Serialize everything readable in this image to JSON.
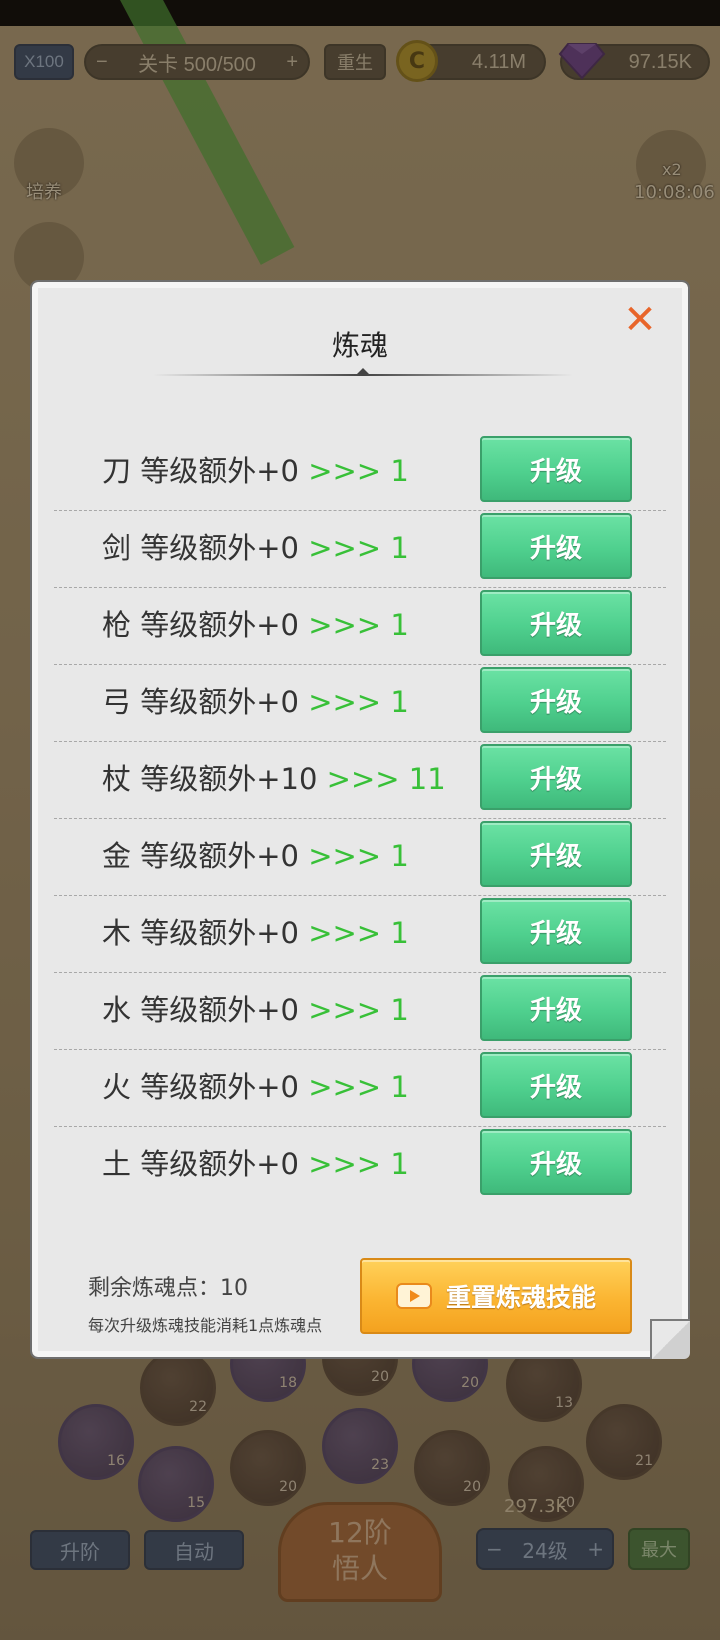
{
  "hud": {
    "multiplier": "X100",
    "stage_label": "关卡",
    "stage_value": "500",
    "stage_max": "500",
    "rebirth": "重生",
    "coins": "4.11M",
    "gems": "97.15K",
    "coin_symbol": "C"
  },
  "side": {
    "train_label": "培养",
    "boost_label": "x2",
    "timer": "10:08:06"
  },
  "bottom": {
    "upgrade_rank": "升阶",
    "auto": "自动",
    "rank_line1": "12阶",
    "rank_line2": "悟人",
    "level_value": "24级",
    "minus": "−",
    "plus": "+",
    "max": "最大",
    "cost": "297.3K"
  },
  "zodiac_levels": [
    "22",
    "18",
    "20",
    "20",
    "13",
    "16",
    "15",
    "20",
    "23",
    "20",
    "20",
    "21"
  ],
  "dialog": {
    "title": "炼魂",
    "close_symbol": "✕",
    "upgrade_label": "升级",
    "rows": [
      {
        "name": "刀",
        "desc": "等级额外+0",
        "arrow": ">>>",
        "next": "1"
      },
      {
        "name": "剑",
        "desc": "等级额外+0",
        "arrow": ">>>",
        "next": "1"
      },
      {
        "name": "枪",
        "desc": "等级额外+0",
        "arrow": ">>>",
        "next": "1"
      },
      {
        "name": "弓",
        "desc": "等级额外+0",
        "arrow": ">>>",
        "next": "1"
      },
      {
        "name": "杖",
        "desc": "等级额外+10",
        "arrow": ">>>",
        "next": "11"
      },
      {
        "name": "金",
        "desc": "等级额外+0",
        "arrow": ">>>",
        "next": "1"
      },
      {
        "name": "木",
        "desc": "等级额外+0",
        "arrow": ">>>",
        "next": "1"
      },
      {
        "name": "水",
        "desc": "等级额外+0",
        "arrow": ">>>",
        "next": "1"
      },
      {
        "name": "火",
        "desc": "等级额外+0",
        "arrow": ">>>",
        "next": "1"
      },
      {
        "name": "土",
        "desc": "等级额外+0",
        "arrow": ">>>",
        "next": "1"
      }
    ],
    "remaining_label": "剩余炼魂点：",
    "remaining_value": "10",
    "note": "每次升级炼魂技能消耗1点炼魂点",
    "reset_label": "重置炼魂技能"
  },
  "colors": {
    "upgrade_button": "#4fd08e",
    "reset_button": "#fbb532",
    "arrow_green": "#38c038",
    "close_orange": "#e8652a"
  }
}
